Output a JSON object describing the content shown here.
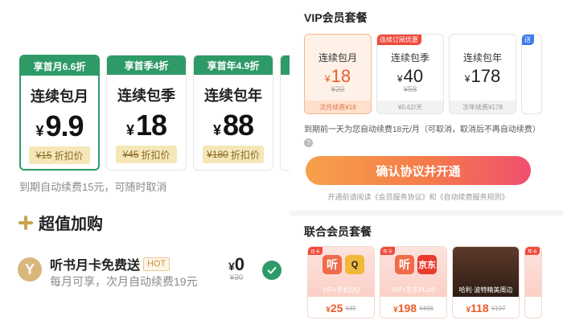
{
  "left": {
    "plans": [
      {
        "tag": "享首月6.6折",
        "name": "连续包月",
        "yen": "¥",
        "price": "9.9",
        "orig": "¥15",
        "disc": "折扣价"
      },
      {
        "tag": "享首季4折",
        "name": "连续包季",
        "yen": "¥",
        "price": "18",
        "orig": "¥45",
        "disc": "折扣价"
      },
      {
        "tag": "享首年4.9折",
        "name": "连续包年",
        "yen": "¥",
        "price": "88",
        "orig": "¥180",
        "disc": "折扣价"
      }
    ],
    "auto_note": "到期自动续费15元，可随时取消",
    "plus_title": "超值加购",
    "addon": {
      "logo": "Y",
      "title": "听书月卡免费送",
      "hot": "HOT",
      "sub": "每月可享，次月自动续费19元",
      "yen": "¥",
      "price": "0",
      "orig": "¥30"
    }
  },
  "right": {
    "vip_title": "VIP会员套餐",
    "plans": [
      {
        "tag": "",
        "name": "连续包月",
        "yen": "¥",
        "price": "18",
        "orig": "¥20",
        "foot": "次月续费¥18"
      },
      {
        "tag": "连续订阅优惠",
        "name": "连续包季",
        "yen": "¥",
        "price": "40",
        "orig": "¥58",
        "foot": "¥0.62/天"
      },
      {
        "tag": "",
        "name": "连续包年",
        "yen": "¥",
        "price": "178",
        "orig": "",
        "foot": "次年续费¥178"
      }
    ],
    "partial_tag": "送",
    "renew_note": "到期前一天为您自动续费18元/月（可取消，取消后不再自动续费）",
    "help_icon": "?",
    "confirm": "确认协议并开通",
    "agree": "开通前请阅读《会员服务协议》和《自动续费服务规则》",
    "joint_title": "联合会员套餐",
    "joint": [
      {
        "badge": "月卡",
        "icon1": "听",
        "icon2": "Q",
        "label": "VIP+手机QQ",
        "yen": "¥",
        "price": "25",
        "orig": "¥45"
      },
      {
        "badge": "年卡",
        "icon1": "听",
        "icon2": "京东",
        "label": "VIP+京东PLUS",
        "yen": "¥",
        "price": "198",
        "orig": "¥466"
      },
      {
        "badge": "",
        "icon1": "",
        "icon2": "",
        "label": "哈利·波特精美周边",
        "yen": "¥",
        "price": "118",
        "orig": "¥197"
      }
    ],
    "joint_partial_badge": "年卡"
  },
  "colors": {
    "green": "#2e9a67",
    "orange": "#f57a4a",
    "gold": "#c8a44c"
  }
}
